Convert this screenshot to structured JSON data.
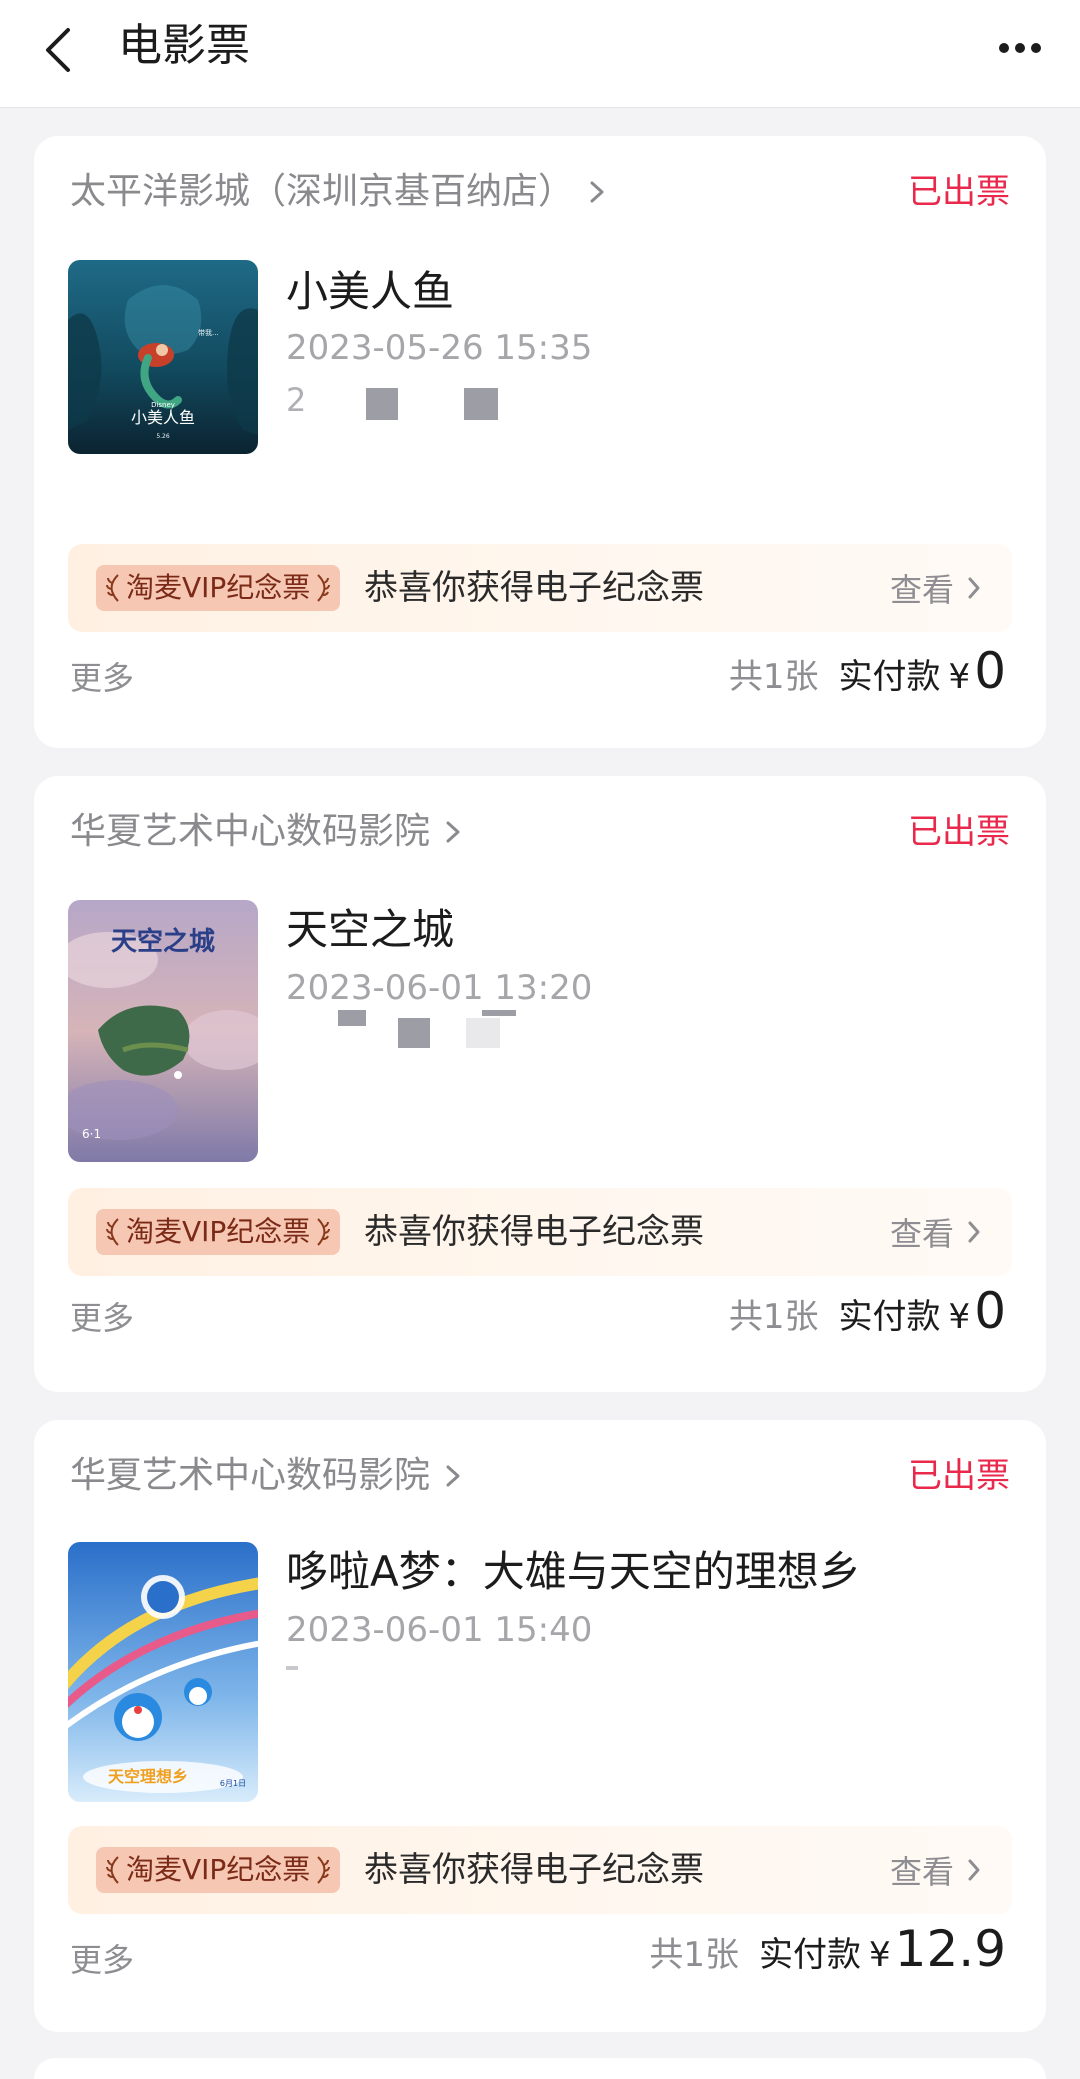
{
  "header": {
    "title": "电影票"
  },
  "orders": [
    {
      "cinema": "太平洋影城（深圳京基百纳店）",
      "status": "已出票",
      "title": "小美人鱼",
      "datetime": "2023-05-26 15:35",
      "seat_visible": "2",
      "poster_icon": "poster-little-mermaid",
      "badge": "淘麦VIP纪念票",
      "souvenir_text": "恭喜你获得电子纪念票",
      "view_label": "查看",
      "more_label": "更多",
      "count": "共1张",
      "paid_label": "实付款",
      "currency": "¥",
      "amount": "0"
    },
    {
      "cinema": "华夏艺术中心数码影院",
      "status": "已出票",
      "title": "天空之城",
      "datetime": "2023-06-01 13:20",
      "seat_visible": "",
      "poster_icon": "poster-castle-in-the-sky",
      "badge": "淘麦VIP纪念票",
      "souvenir_text": "恭喜你获得电子纪念票",
      "view_label": "查看",
      "more_label": "更多",
      "count": "共1张",
      "paid_label": "实付款",
      "currency": "¥",
      "amount": "0"
    },
    {
      "cinema": "华夏艺术中心数码影院",
      "status": "已出票",
      "title": "哆啦A梦：大雄与天空的理想乡",
      "datetime": "2023-06-01 15:40",
      "seat_visible": "",
      "poster_icon": "poster-doraemon",
      "badge": "淘麦VIP纪念票",
      "souvenir_text": "恭喜你获得电子纪念票",
      "view_label": "查看",
      "more_label": "更多",
      "count": "共1张",
      "paid_label": "实付款",
      "currency": "¥",
      "amount": "12.9"
    }
  ],
  "colors": {
    "status_red": "#e8294c",
    "badge_bg": "#f6c7b3",
    "page_bg": "#f3f3f5"
  }
}
